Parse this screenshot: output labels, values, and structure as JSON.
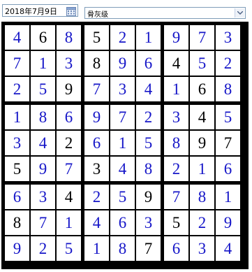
{
  "toolbar": {
    "date_value": "2018年7月9日",
    "calendar_icon": "calendar-icon",
    "level_value": "骨灰级",
    "dropdown_icon": "chevron-down-icon"
  },
  "colors": {
    "given": "#000000",
    "entry": "#1515c8",
    "grid": "#000000"
  },
  "sudoku": {
    "rows": [
      [
        "4",
        "6",
        "8",
        "5",
        "2",
        "1",
        "9",
        "7",
        "3"
      ],
      [
        "7",
        "1",
        "3",
        "8",
        "9",
        "6",
        "4",
        "5",
        "2"
      ],
      [
        "2",
        "5",
        "9",
        "7",
        "3",
        "4",
        "1",
        "6",
        "8"
      ],
      [
        "1",
        "8",
        "6",
        "9",
        "7",
        "2",
        "3",
        "4",
        "5"
      ],
      [
        "3",
        "4",
        "2",
        "6",
        "1",
        "5",
        "8",
        "9",
        "7"
      ],
      [
        "5",
        "9",
        "7",
        "3",
        "4",
        "8",
        "2",
        "1",
        "6"
      ],
      [
        "6",
        "3",
        "4",
        "2",
        "5",
        "9",
        "7",
        "8",
        "1"
      ],
      [
        "8",
        "7",
        "1",
        "4",
        "6",
        "3",
        "5",
        "2",
        "9"
      ],
      [
        "9",
        "2",
        "5",
        "1",
        "8",
        "7",
        "6",
        "3",
        "4"
      ]
    ],
    "given": [
      [
        0,
        1,
        0,
        1,
        0,
        0,
        0,
        0,
        0
      ],
      [
        0,
        0,
        0,
        1,
        0,
        0,
        1,
        0,
        0
      ],
      [
        0,
        0,
        1,
        0,
        0,
        0,
        0,
        1,
        0
      ],
      [
        0,
        0,
        0,
        0,
        0,
        0,
        0,
        1,
        0
      ],
      [
        0,
        0,
        1,
        0,
        0,
        0,
        0,
        1,
        1
      ],
      [
        1,
        0,
        0,
        1,
        0,
        0,
        0,
        0,
        0
      ],
      [
        0,
        0,
        1,
        0,
        0,
        1,
        0,
        0,
        0
      ],
      [
        1,
        0,
        0,
        0,
        0,
        0,
        1,
        0,
        0
      ],
      [
        0,
        0,
        0,
        0,
        0,
        1,
        0,
        0,
        0
      ]
    ]
  }
}
